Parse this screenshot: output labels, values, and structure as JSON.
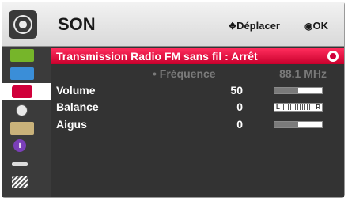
{
  "header": {
    "title": "SON",
    "move_hint": "Déplacer",
    "ok_hint": "OK"
  },
  "sidebar": {
    "items": [
      {
        "name": "picture-tab-icon",
        "color": "#76b52a"
      },
      {
        "name": "screen-tab-icon",
        "color": "#3a8ed8"
      },
      {
        "name": "sound-tab-icon",
        "color": "#d0003a"
      },
      {
        "name": "time-tab-icon",
        "color": "#e8e8e8"
      },
      {
        "name": "option-tab-icon",
        "color": "#c9b27a"
      },
      {
        "name": "info-tab-icon",
        "color": "#7a3fb8"
      },
      {
        "name": "input-tab-icon",
        "color": "#dcdcdc"
      },
      {
        "name": "media-tab-icon",
        "color": "#9a9a9a"
      }
    ],
    "selected_index": 2
  },
  "menu": {
    "rows": [
      {
        "label": "Transmission Radio FM sans fil : Arrêt",
        "value": "",
        "selected": true
      },
      {
        "label": "• Fréquence",
        "value": "88.1 MHz",
        "disabled": true
      },
      {
        "label": "Volume",
        "value": "50",
        "level": 0.5
      },
      {
        "label": "Balance",
        "value": "0"
      },
      {
        "label": "Aigus",
        "value": "0",
        "level": 0.5
      }
    ]
  },
  "balance_bar": {
    "left": "L",
    "right": "R"
  },
  "colors": {
    "accent": "#e8003a",
    "panel": "#333333",
    "header": "#e6e6e6"
  }
}
